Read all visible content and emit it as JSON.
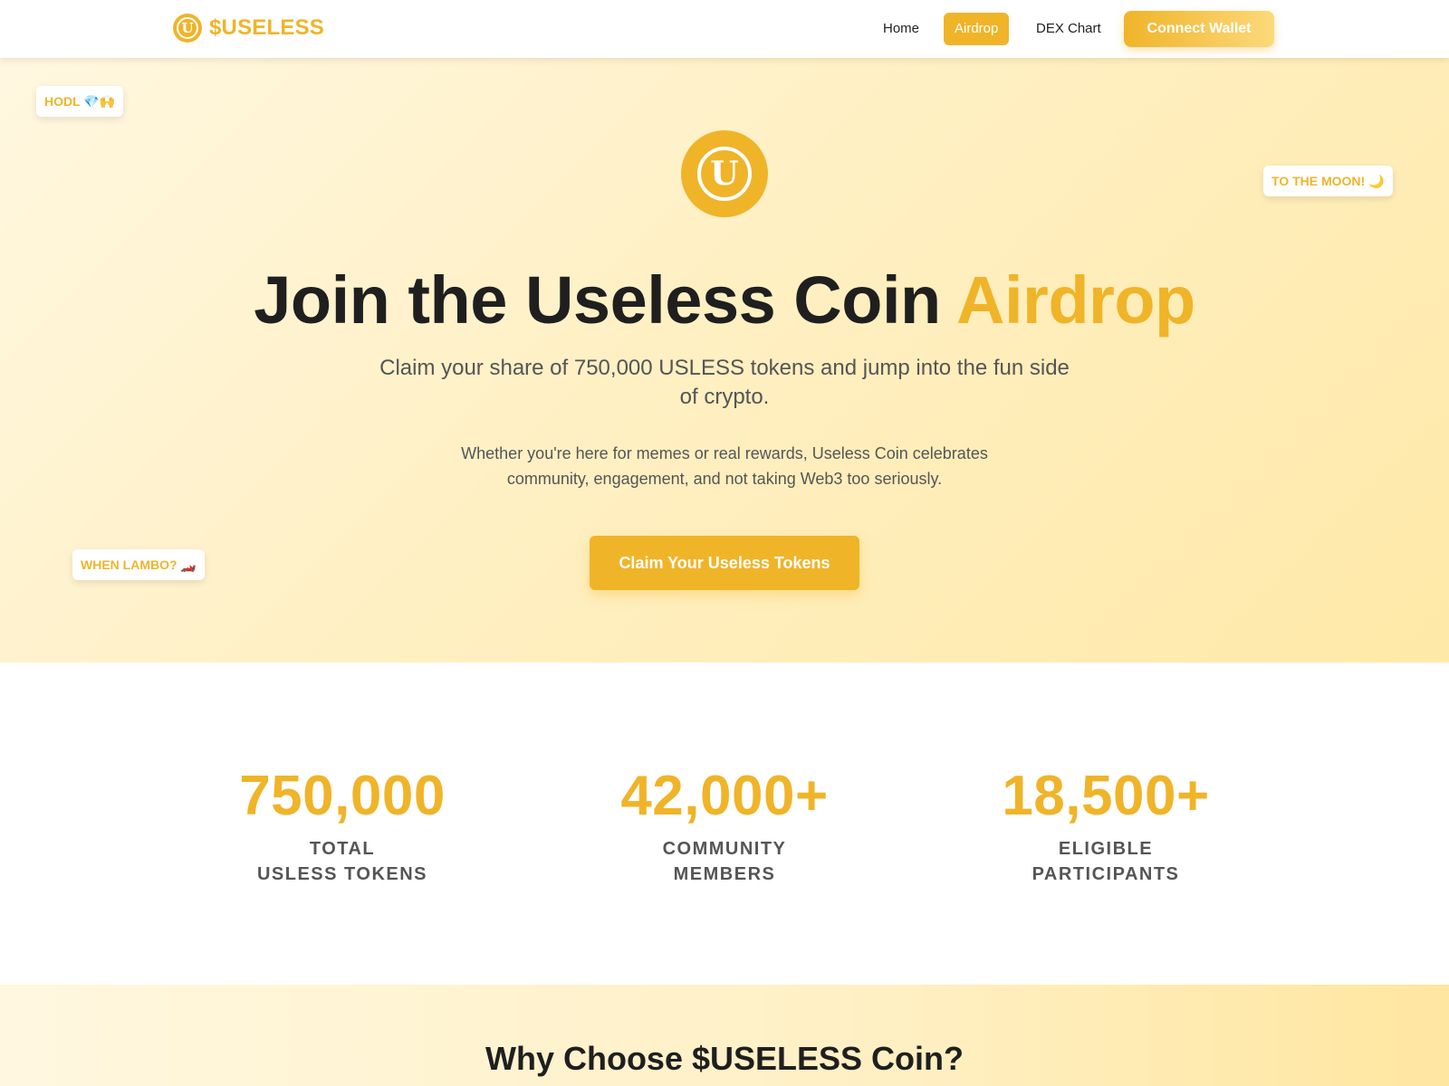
{
  "nav": {
    "brand": "$USELESS",
    "logo_letter": "U",
    "links": [
      {
        "label": "Home",
        "active": false
      },
      {
        "label": "Airdrop",
        "active": true
      },
      {
        "label": "DEX Chart",
        "active": false
      }
    ],
    "connect_label": "Connect Wallet"
  },
  "hero": {
    "stickers": {
      "hodl": "HODL 💎🙌",
      "moon": "TO THE MOON! 🌙",
      "lambo": "WHEN LAMBO? 🏎️"
    },
    "coin_letter": "U",
    "title_main": "Join the Useless Coin",
    "title_accent": "Airdrop",
    "subtitle": "Claim your share of 750,000 USLESS tokens and jump into the fun side of crypto.",
    "description": "Whether you're here for memes or real rewards, Useless Coin celebrates community, engagement, and not taking Web3 too seriously.",
    "cta_label": "Claim Your Useless Tokens"
  },
  "stats": [
    {
      "value": "750,000",
      "label_line1": "TOTAL",
      "label_line2": "USLESS TOKENS"
    },
    {
      "value": "42,000+",
      "label_line1": "COMMUNITY",
      "label_line2": "MEMBERS"
    },
    {
      "value": "18,500+",
      "label_line1": "ELIGIBLE",
      "label_line2": "PARTICIPANTS"
    }
  ],
  "why": {
    "title": "Why Choose $USELESS Coin?"
  },
  "colors": {
    "accent": "#f0b429",
    "text_dark": "#1f1f1f",
    "text_muted": "#555555"
  }
}
